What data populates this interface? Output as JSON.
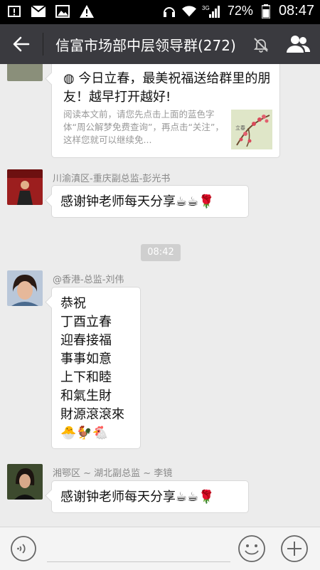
{
  "statusbar": {
    "battery_percent": "72%",
    "time": "08:47",
    "network": "3G"
  },
  "header": {
    "title": "信富市场部中层领导群(272)",
    "muted": true
  },
  "messages": [
    {
      "type": "link-card",
      "card_title": "◍ 今日立春，最美祝福送给群里的朋友！越早打开越好!",
      "card_desc": "阅读本文前，请您先点击上面的蓝色字体“周公解梦免费查询”，再点击“关注”，这样您就可以继续免...",
      "thumb_caption": "立春"
    },
    {
      "type": "text",
      "sender": "川渝滇区-重庆副总监-彭光书",
      "text": "感谢钟老师每天分享",
      "emojis": [
        "☕",
        "☕",
        "🌹"
      ]
    },
    {
      "type": "time",
      "text": "08:42"
    },
    {
      "type": "text",
      "sender": "@香港-总监-刘伟",
      "lines": [
        "恭祝",
        "丁酉立春",
        "迎春接福",
        "事事如意",
        "上下和睦",
        "和氣生財",
        "財源滾滾來"
      ],
      "emojis": [
        "🐣",
        "🐓",
        "🐔"
      ]
    },
    {
      "type": "text",
      "sender": "湘鄂区 ~ 湖北副总监 ~ 李镜",
      "text": "感谢钟老师每天分享",
      "emojis": [
        "☕",
        "☕",
        "🌹"
      ]
    }
  ],
  "icons": {
    "back": "arrow-left-icon",
    "mute": "bell-off-icon",
    "members": "people-icon",
    "voice": "voice-icon",
    "emoji": "smiley-icon",
    "plus": "plus-icon"
  }
}
